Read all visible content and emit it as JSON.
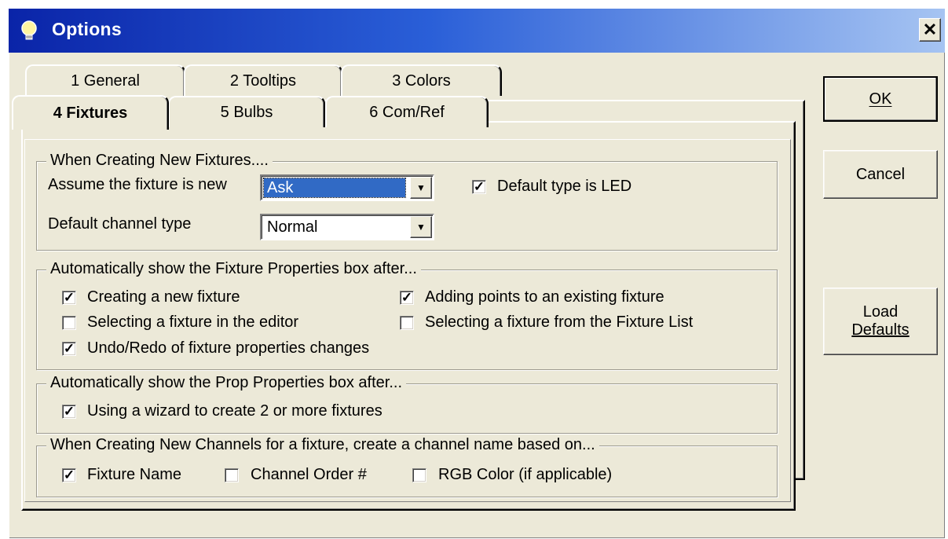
{
  "window": {
    "title": "Options"
  },
  "buttons": {
    "ok": "OK",
    "cancel": "Cancel",
    "load_defaults_line1": "Load",
    "load_defaults_line2": "Defaults"
  },
  "tabs": {
    "back_row": [
      "1 General",
      "2 Tooltips",
      "3 Colors"
    ],
    "front_row": [
      "4 Fixtures",
      "5 Bulbs",
      "6 Com/Ref"
    ],
    "active": "4 Fixtures"
  },
  "groups": {
    "new_fixtures": {
      "label": "When Creating New Fixtures....",
      "assume_label": "Assume the fixture is new",
      "assume_value": "Ask",
      "channel_type_label": "Default channel type",
      "channel_type_value": "Normal",
      "led_label": "Default type is LED",
      "led_checked": true
    },
    "fixture_props": {
      "label": "Automatically show the Fixture Properties box after...",
      "items": [
        {
          "label": "Creating a new fixture",
          "checked": true
        },
        {
          "label": "Adding points to an existing fixture",
          "checked": true
        },
        {
          "label": "Selecting a fixture in the editor",
          "checked": false
        },
        {
          "label": "Selecting a fixture from the Fixture List",
          "checked": false
        },
        {
          "label": "Undo/Redo of fixture properties changes",
          "checked": true
        }
      ]
    },
    "prop_props": {
      "label": "Automatically show the Prop Properties box after...",
      "items": [
        {
          "label": "Using a wizard to create 2 or more fixtures",
          "checked": true
        }
      ]
    },
    "channels": {
      "label": "When Creating New Channels for a fixture, create a channel name based on...",
      "items": [
        {
          "label": "Fixture Name",
          "checked": true
        },
        {
          "label": "Channel Order #",
          "checked": false
        },
        {
          "label": "RGB Color (if applicable)",
          "checked": false
        }
      ]
    }
  }
}
